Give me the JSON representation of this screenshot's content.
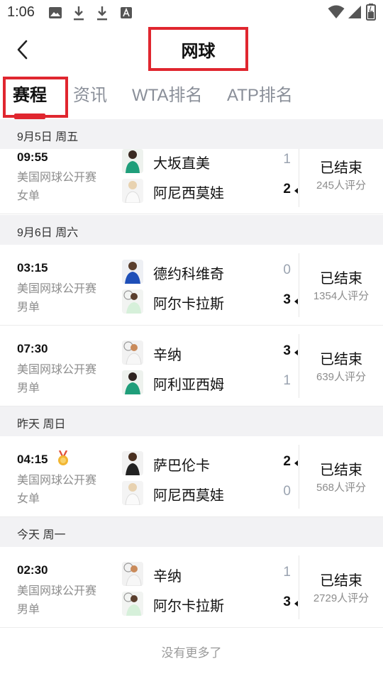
{
  "status_bar": {
    "time": "1:06",
    "left_icons": [
      "image-icon",
      "download-icon",
      "download-icon",
      "a-box-icon"
    ],
    "right_icons": [
      "wifi-icon",
      "signal-icon",
      "battery-icon"
    ]
  },
  "header": {
    "title": "网球",
    "back_icon": "chevron-left-icon"
  },
  "tabs": [
    {
      "label": "赛程",
      "active": true
    },
    {
      "label": "资讯",
      "active": false
    },
    {
      "label": "WTA排名",
      "active": false
    },
    {
      "label": "ATP排名",
      "active": false
    }
  ],
  "accent_color": "#e0262f",
  "days": [
    {
      "date": "9月5日 周五",
      "matches": [
        {
          "time": "09:55",
          "competition": "美国网球公开赛",
          "category": "女单",
          "players": [
            {
              "name": "大坂直美",
              "score": "1",
              "winner": false
            },
            {
              "name": "阿尼西莫娃",
              "score": "2",
              "winner": true
            }
          ],
          "status": "已结束",
          "rating": "245人评分"
        }
      ]
    },
    {
      "date": "9月6日 周六",
      "matches": [
        {
          "time": "03:15",
          "competition": "美国网球公开赛",
          "category": "男单",
          "players": [
            {
              "name": "德约科维奇",
              "score": "0",
              "winner": false
            },
            {
              "name": "阿尔卡拉斯",
              "score": "3",
              "winner": true
            }
          ],
          "status": "已结束",
          "rating": "1354人评分"
        },
        {
          "time": "07:30",
          "competition": "美国网球公开赛",
          "category": "男单",
          "players": [
            {
              "name": "辛纳",
              "score": "3",
              "winner": true
            },
            {
              "name": "阿利亚西姆",
              "score": "1",
              "winner": false
            }
          ],
          "status": "已结束",
          "rating": "639人评分"
        }
      ]
    },
    {
      "date": "昨天 周日",
      "matches": [
        {
          "time": "04:15",
          "medal_icon": "gold-medal-icon",
          "competition": "美国网球公开赛",
          "category": "女单",
          "players": [
            {
              "name": "萨巴伦卡",
              "score": "2",
              "winner": true
            },
            {
              "name": "阿尼西莫娃",
              "score": "0",
              "winner": false
            }
          ],
          "status": "已结束",
          "rating": "568人评分"
        }
      ]
    },
    {
      "date": "今天 周一",
      "matches": [
        {
          "time": "02:30",
          "competition": "美国网球公开赛",
          "category": "男单",
          "players": [
            {
              "name": "辛纳",
              "score": "1",
              "winner": false
            },
            {
              "name": "阿尔卡拉斯",
              "score": "3",
              "winner": true
            }
          ],
          "status": "已结束",
          "rating": "2729人评分"
        }
      ]
    }
  ],
  "footer": {
    "no_more": "没有更多了"
  }
}
